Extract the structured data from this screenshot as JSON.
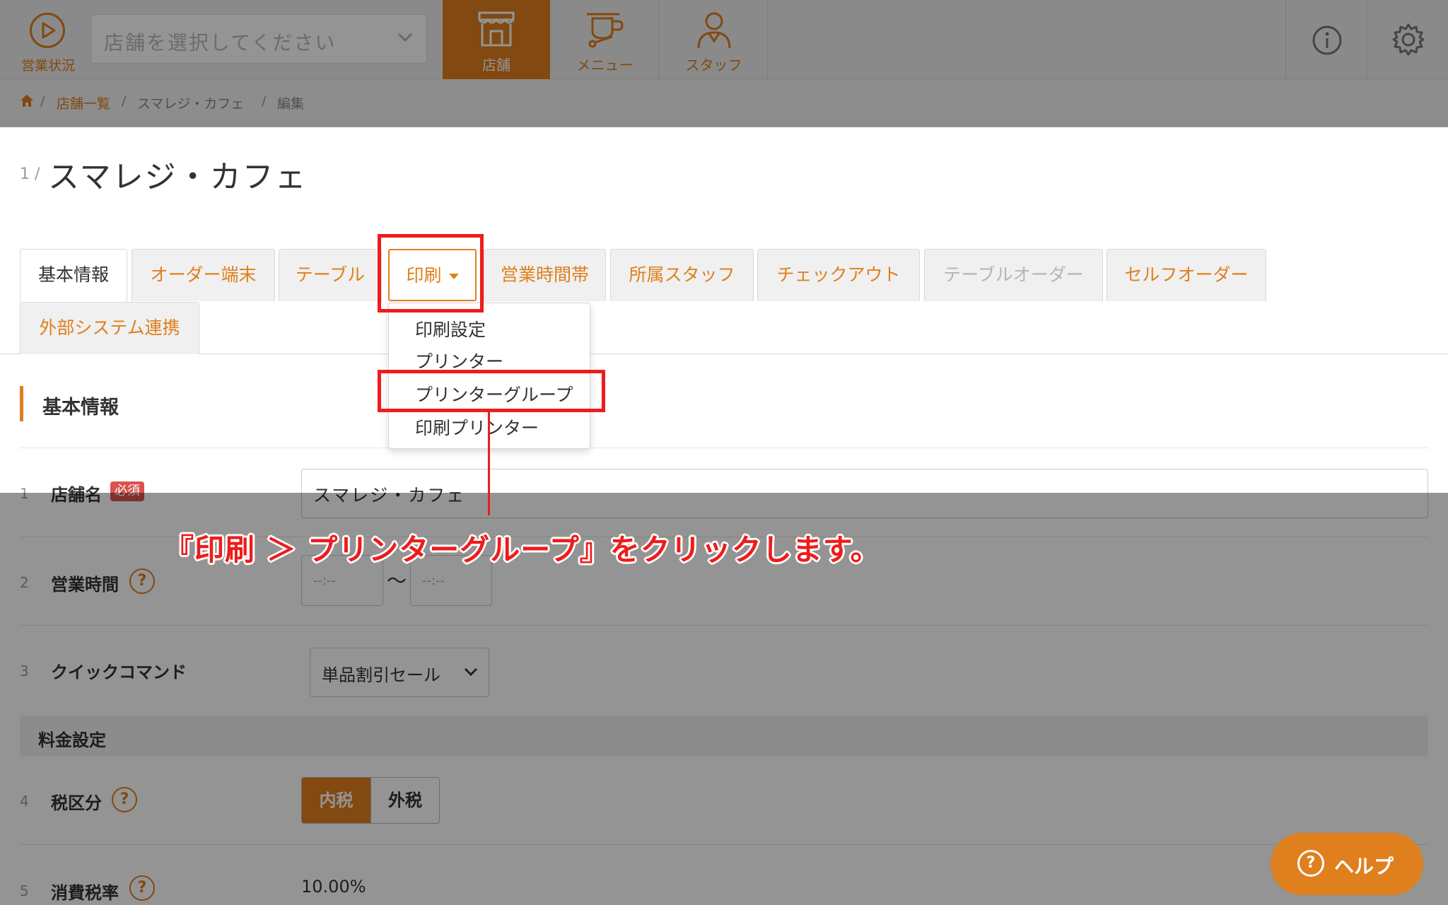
{
  "header": {
    "status_label": "営業状況",
    "store_select_placeholder": "店舗を選択してください",
    "nav": [
      {
        "label": "店舗",
        "icon": "storefront-icon",
        "active": true
      },
      {
        "label": "メニュー",
        "icon": "coffee-cup-icon",
        "active": false
      },
      {
        "label": "スタッフ",
        "icon": "staff-person-icon",
        "active": false
      }
    ]
  },
  "breadcrumb": {
    "sep": "/",
    "items": [
      "店舗一覧",
      "スマレジ・カフェ",
      "編集"
    ]
  },
  "page": {
    "index": "1 /",
    "title": "スマレジ・カフェ"
  },
  "tabs": [
    {
      "label": "基本情報",
      "state": "active"
    },
    {
      "label": "オーダー端末",
      "state": "normal"
    },
    {
      "label": "テーブル",
      "state": "normal"
    },
    {
      "label": "印刷",
      "state": "open"
    },
    {
      "label": "営業時間帯",
      "state": "normal"
    },
    {
      "label": "所属スタッフ",
      "state": "normal"
    },
    {
      "label": "チェックアウト",
      "state": "normal"
    },
    {
      "label": "テーブルオーダー",
      "state": "disabled"
    },
    {
      "label": "セルフオーダー",
      "state": "normal"
    },
    {
      "label": "外部システム連携",
      "state": "normal"
    }
  ],
  "print_menu": [
    "印刷設定",
    "プリンター",
    "プリンターグループ",
    "印刷プリンター"
  ],
  "section": {
    "title": "基本情報"
  },
  "form": {
    "store_name": {
      "num": "1",
      "label": "店舗名",
      "required": "必須",
      "value": "スマレジ・カフェ"
    },
    "hours": {
      "num": "2",
      "label": "営業時間",
      "help": "?",
      "start_placeholder": "--:--",
      "sep": "〜",
      "end_placeholder": "--:--"
    },
    "quick_command": {
      "num": "3",
      "label": "クイックコマンド",
      "value": "単品割引セール"
    },
    "pricing_header": "料金設定",
    "tax_type": {
      "num": "4",
      "label": "税区分",
      "help": "?",
      "options": [
        "内税",
        "外税"
      ],
      "selected": "内税"
    },
    "tax_rate": {
      "num": "5",
      "label": "消費税率",
      "help": "?",
      "value": "10.00%"
    }
  },
  "annotation": "『印刷 ＞ プリンターグループ』をクリックします。",
  "help_button": {
    "icon_text": "?",
    "label": "ヘルプ"
  },
  "colors": {
    "accent": "#e07f1d",
    "highlight": "#ee1c1c",
    "required_badge": "#d9534f"
  }
}
